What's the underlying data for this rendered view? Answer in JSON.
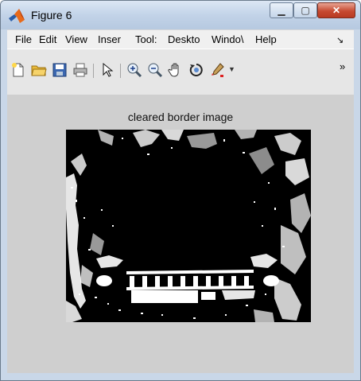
{
  "window": {
    "title": "Figure 6",
    "minimize_glyph": "▁",
    "maximize_glyph": "▢",
    "close_glyph": "✕"
  },
  "menu": {
    "items": [
      "File",
      "Edit",
      "View",
      "Inser",
      "Tool:",
      "Deskto",
      "Windo\\",
      "Help"
    ],
    "overflow_glyph": "↘"
  },
  "toolbar": {
    "icons": [
      "new-figure-icon",
      "open-file-icon",
      "save-figure-icon",
      "print-figure-icon",
      "edit-plot-arrow-icon",
      "zoom-in-icon",
      "zoom-out-icon",
      "pan-hand-icon",
      "rotate-3d-icon",
      "data-cursor-icon"
    ],
    "overflow_glyph": "»"
  },
  "plot": {
    "title": "cleared border image",
    "colors": {
      "background": "#000000",
      "foreground": "#ffffff"
    }
  }
}
